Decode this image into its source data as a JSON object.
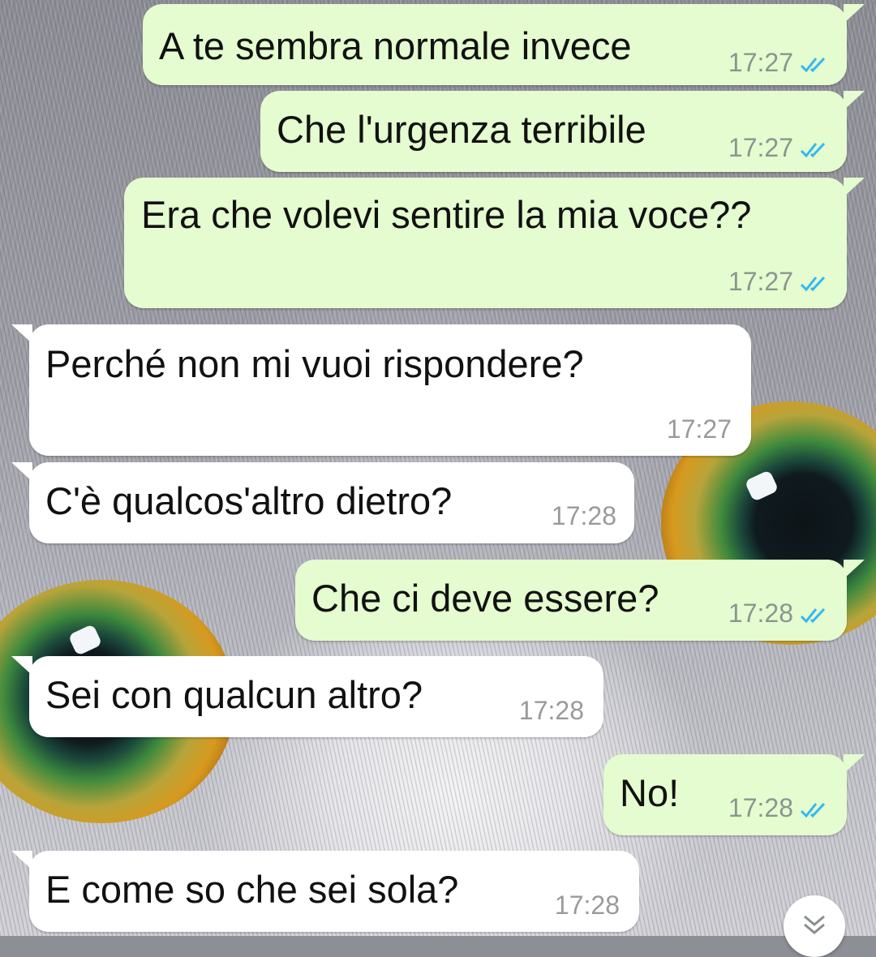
{
  "chat": {
    "messages": [
      {
        "direction": "out",
        "text": "A te sembra normale invece",
        "time": "17:27",
        "status": "read"
      },
      {
        "direction": "out",
        "text": "Che l'urgenza terribile",
        "time": "17:27",
        "status": "read"
      },
      {
        "direction": "out",
        "text": "Era che volevi sentire la mia voce??",
        "time": "17:27",
        "status": "read"
      },
      {
        "direction": "in",
        "text": "Perché non mi vuoi rispondere?",
        "time": "17:27"
      },
      {
        "direction": "in",
        "text": "C'è qualcos'altro dietro?",
        "time": "17:28"
      },
      {
        "direction": "out",
        "text": "Che ci deve essere?",
        "time": "17:28",
        "status": "read"
      },
      {
        "direction": "in",
        "text": "Sei con qualcun altro?",
        "time": "17:28"
      },
      {
        "direction": "out",
        "text": "No!",
        "time": "17:28",
        "status": "read"
      },
      {
        "direction": "in",
        "text": "E come so che sei sola?",
        "time": "17:28"
      }
    ]
  },
  "colors": {
    "outgoing_bubble": "#e4fccf",
    "incoming_bubble": "#ffffff",
    "read_ticks": "#34b7f1"
  },
  "icons": {
    "read_receipt": "double-check-icon",
    "scroll_down": "double-chevron-down-icon"
  }
}
